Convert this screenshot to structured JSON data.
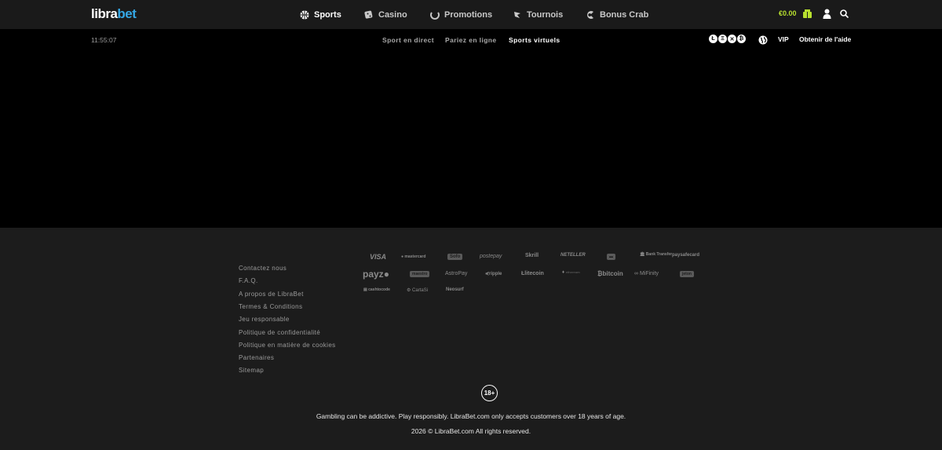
{
  "header": {
    "logo_part1": "libra",
    "logo_part2": "bet",
    "nav": [
      {
        "label": "Sports",
        "icon": "sports-ball-icon"
      },
      {
        "label": "Casino",
        "icon": "casino-dice-icon"
      },
      {
        "label": "Promotions",
        "icon": "promotions-icon"
      },
      {
        "label": "Tournois",
        "icon": "tournament-icon"
      },
      {
        "label": "Bonus Crab",
        "icon": "bonus-crab-icon"
      }
    ],
    "balance": "€0.00"
  },
  "subheader": {
    "clock": "11:55:07",
    "tabs": [
      "Sport en direct",
      "Pariez en ligne",
      "Sports virtuels"
    ],
    "crypto_letters": [
      "Ł",
      "Ξ",
      "✕",
      "₿"
    ],
    "vip": "VIP",
    "help": "Obtenir de l'aide"
  },
  "footer": {
    "links": [
      "Contactez nous",
      "F.A.Q.",
      "A propos de LibraBet",
      "Termes & Conditions",
      "Jeu responsable",
      "Politique de confidentialité",
      "Politique en matière de cookies",
      "Partenaires",
      "Sitemap"
    ],
    "payments": {
      "visa": "VISA",
      "mastercard": "mastercard",
      "sofort": "Sofo",
      "postepay": "postepay",
      "skrill": "Skrill",
      "neteller": "NETELLER",
      "bank": "Bank Transfer",
      "paysafecard": "paysafecard",
      "payz": "payz",
      "maestro": "maestro",
      "astropay": "AstroPay",
      "ripple": "ripple",
      "litecoin": "litecoin",
      "ethereum": "ethereum",
      "bitcoin": "bitcoin",
      "mifinity": "MiFinity",
      "jeton": "jeton",
      "cashtocode": "cashtocode",
      "cartasi": "CartaSi",
      "neosurf": "Neosurf"
    },
    "age": "18+",
    "disclaimer": "Gambling can be addictive. Play responsibly. LibraBet.com only accepts customers over 18 years of age.",
    "copyright": "2026 © LibraBet.com All rights reserved."
  }
}
